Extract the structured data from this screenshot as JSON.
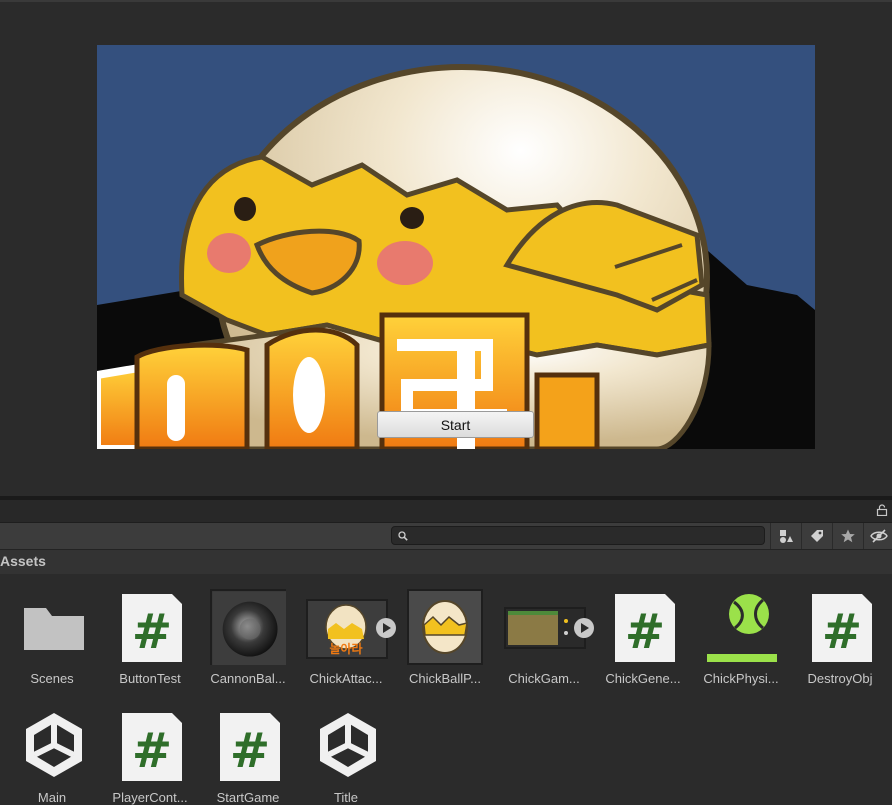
{
  "game": {
    "start_label": "Start"
  },
  "toolbar": {
    "search_placeholder": "",
    "icons": [
      "lock-icon",
      "search-icon",
      "filter-type-icon",
      "label-icon",
      "favorite-icon",
      "hidden-icon"
    ]
  },
  "assets": {
    "title": "Assets",
    "items": [
      {
        "label": "Scenes",
        "icon": "folder-icon"
      },
      {
        "label": "ButtonTest",
        "icon": "csharp-script-icon"
      },
      {
        "label": "CannonBal...",
        "icon": "cannonball-texture-icon"
      },
      {
        "label": "ChickAttac...",
        "icon": "chick-attack-sprite-icon"
      },
      {
        "label": "ChickBallP...",
        "icon": "chick-ball-prefab-icon"
      },
      {
        "label": "ChickGam...",
        "icon": "chick-game-sprite-icon"
      },
      {
        "label": "ChickGene...",
        "icon": "csharp-script-icon"
      },
      {
        "label": "ChickPhysi...",
        "icon": "physics-material-icon"
      },
      {
        "label": "DestroyObj",
        "icon": "csharp-script-icon"
      },
      {
        "label": "Main",
        "icon": "unity-scene-icon"
      },
      {
        "label": "PlayerCont...",
        "icon": "csharp-script-icon"
      },
      {
        "label": "StartGame",
        "icon": "csharp-script-icon"
      },
      {
        "label": "Title",
        "icon": "unity-scene-icon"
      }
    ]
  },
  "colors": {
    "panel_bg": "#2b2b2b",
    "game_bg": "#34507e",
    "script_green": "#2f6e2a",
    "physics_green": "#9be14a"
  }
}
